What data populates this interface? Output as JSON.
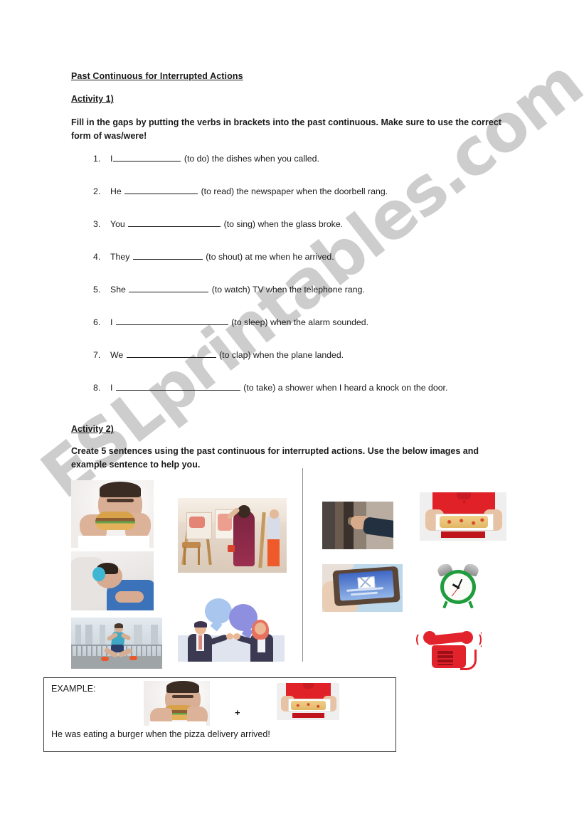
{
  "document": {
    "title": "Past Continuous for Interrupted Actions",
    "watermark": "ESLprintables.com"
  },
  "activity1": {
    "heading": "Activity 1)",
    "instructions": "Fill in the gaps by putting the verbs in brackets into the past continuous. Make sure to use the correct form of was/were!",
    "questions": [
      {
        "num": "1.",
        "subject": "I",
        "space_before_blank": false,
        "blank_width": 95,
        "rest": "(to do) the dishes when you called."
      },
      {
        "num": "2.",
        "subject": "He",
        "space_before_blank": true,
        "blank_width": 103,
        "rest": "(to read) the newspaper when the doorbell rang."
      },
      {
        "num": "3.",
        "subject": "You",
        "space_before_blank": true,
        "blank_width": 130,
        "rest": "(to sing) when the glass broke."
      },
      {
        "num": "4.",
        "subject": "They",
        "space_before_blank": true,
        "blank_width": 98,
        "rest": "(to shout) at me when he arrived."
      },
      {
        "num": "5.",
        "subject": "She",
        "space_before_blank": true,
        "blank_width": 112,
        "rest": "(to watch) TV when the telephone rang."
      },
      {
        "num": "6.",
        "subject": "I",
        "space_before_blank": true,
        "blank_width": 158,
        "rest": "(to sleep) when the alarm sounded."
      },
      {
        "num": "7.",
        "subject": "We",
        "space_before_blank": true,
        "blank_width": 126,
        "rest": "(to clap) when the plane landed."
      },
      {
        "num": "8.",
        "subject": "I",
        "space_before_blank": true,
        "blank_width": 175,
        "rest": "(to take) a shower when I heard a knock on the door."
      }
    ]
  },
  "activity2": {
    "heading": "Activity 2)",
    "instructions": "Create 5 sentences using the past continuous for interrupted actions. Use the below images and example sentence to help you.",
    "action_images": [
      {
        "name": "man-eating-burger"
      },
      {
        "name": "man-sleeping-with-headphones"
      },
      {
        "name": "woman-jogging"
      },
      {
        "name": "art-class-painting"
      },
      {
        "name": "two-people-talking"
      }
    ],
    "interruption_images": [
      {
        "name": "hand-on-doorknob"
      },
      {
        "name": "phone-new-message"
      },
      {
        "name": "pizza-delivery"
      },
      {
        "name": "green-alarm-clock"
      },
      {
        "name": "red-ringing-telephone"
      }
    ]
  },
  "example": {
    "label": "EXAMPLE:",
    "plus": "+",
    "sentence": "He was eating a burger when the pizza delivery arrived!",
    "left_image": "man-eating-burger",
    "right_image": "pizza-delivery"
  },
  "colors": {
    "text": "#1a1a1a",
    "watermark": "#c9c9c9",
    "box_border": "#3b3b3b",
    "divider": "#8d8d8d"
  }
}
